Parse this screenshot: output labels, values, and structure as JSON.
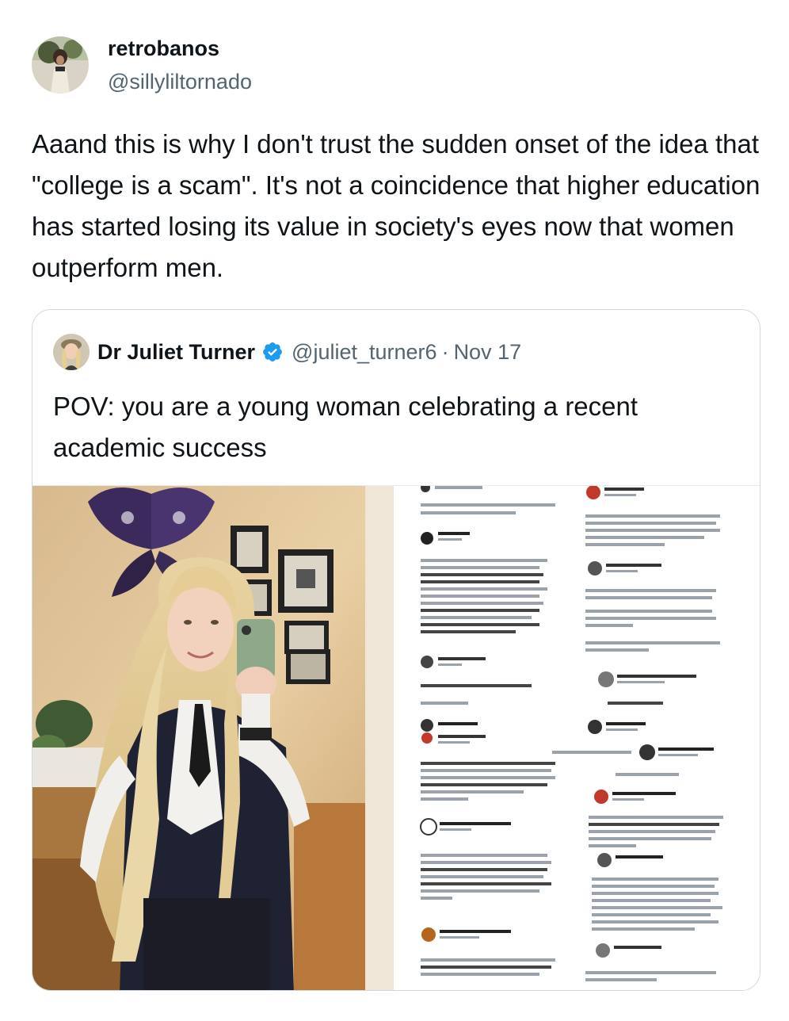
{
  "tweet": {
    "display_name": "retrobanos",
    "handle": "@sillyliltornado",
    "text": "Aaand this is why I don't trust the sudden onset of the idea that \"college is a scam\". It's not a coincidence that higher education has started losing its value in society's eyes now that women outperform men."
  },
  "quoted_tweet": {
    "display_name": "Dr Juliet Turner",
    "verified": true,
    "handle": "@juliet_turner6",
    "separator": "·",
    "date": "Nov 17",
    "text": "POV: you are a young woman celebrating a recent academic success"
  },
  "colors": {
    "text_primary": "#0f1419",
    "text_secondary": "#536471",
    "border": "#cfd9de",
    "verified_blue": "#1d9bf0"
  },
  "icons": {
    "verified": "verified-badge-icon"
  }
}
